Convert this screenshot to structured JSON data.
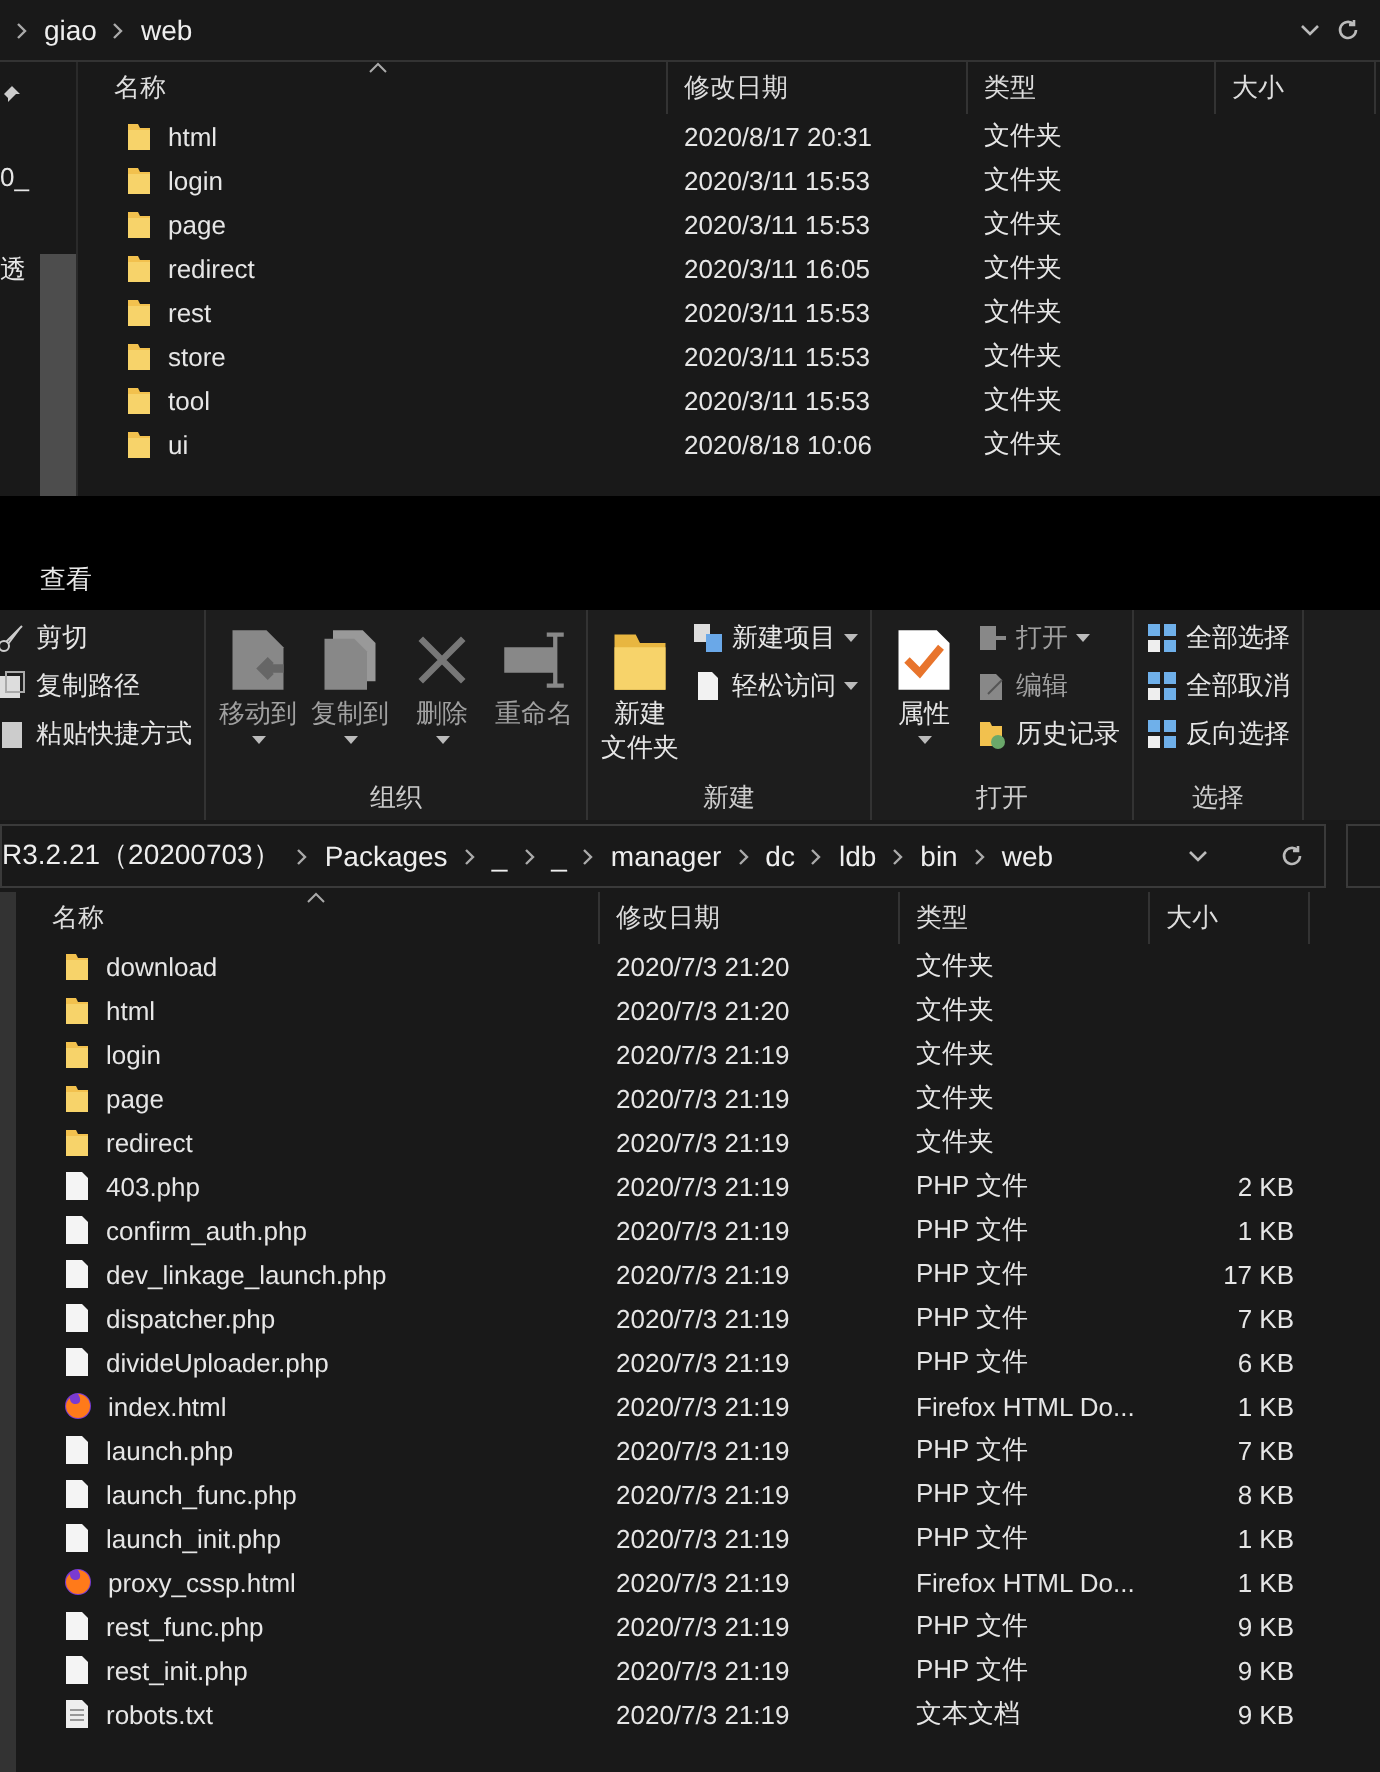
{
  "top_window": {
    "breadcrumb": [
      "giao",
      "web"
    ],
    "nav_pane": {
      "items": [
        "0_",
        "透"
      ]
    },
    "columns": [
      "名称",
      "修改日期",
      "类型",
      "大小"
    ],
    "rows": [
      {
        "name": "html",
        "modified": "2020/8/17 20:31",
        "type": "文件夹",
        "kind": "folder"
      },
      {
        "name": "login",
        "modified": "2020/3/11 15:53",
        "type": "文件夹",
        "kind": "folder"
      },
      {
        "name": "page",
        "modified": "2020/3/11 15:53",
        "type": "文件夹",
        "kind": "folder"
      },
      {
        "name": "redirect",
        "modified": "2020/3/11 16:05",
        "type": "文件夹",
        "kind": "folder"
      },
      {
        "name": "rest",
        "modified": "2020/3/11 15:53",
        "type": "文件夹",
        "kind": "folder"
      },
      {
        "name": "store",
        "modified": "2020/3/11 15:53",
        "type": "文件夹",
        "kind": "folder"
      },
      {
        "name": "tool",
        "modified": "2020/3/11 15:53",
        "type": "文件夹",
        "kind": "folder"
      },
      {
        "name": "ui",
        "modified": "2020/8/18 10:06",
        "type": "文件夹",
        "kind": "folder"
      }
    ]
  },
  "ribbon": {
    "tab": "查看",
    "groups": [
      {
        "items": [
          {
            "label": "剪切",
            "kind": "small",
            "disabled": false,
            "dropdown": false
          },
          {
            "label": "复制路径",
            "kind": "small",
            "disabled": false,
            "dropdown": false
          },
          {
            "label": "粘贴快捷方式",
            "kind": "small",
            "disabled": false,
            "dropdown": false
          }
        ]
      },
      {
        "label": "组织",
        "items": [
          {
            "label": "移动到",
            "kind": "large",
            "disabled": true,
            "dropdown": true
          },
          {
            "label": "复制到",
            "kind": "large",
            "disabled": true,
            "dropdown": true
          },
          {
            "label": "删除",
            "kind": "large",
            "disabled": true,
            "dropdown": true
          },
          {
            "label": "重命名",
            "kind": "large",
            "disabled": true,
            "dropdown": false
          }
        ]
      },
      {
        "label": "新建",
        "items": [
          {
            "label": "新建文件夹",
            "kind": "large",
            "disabled": false,
            "dropdown": false
          },
          {
            "label": "新建项目",
            "kind": "small",
            "disabled": false,
            "dropdown": true
          },
          {
            "label": "轻松访问",
            "kind": "small",
            "disabled": false,
            "dropdown": true
          }
        ]
      },
      {
        "label": "打开",
        "items": [
          {
            "label": "属性",
            "kind": "large",
            "disabled": false,
            "dropdown": true
          },
          {
            "label": "打开",
            "kind": "small",
            "disabled": true,
            "dropdown": true
          },
          {
            "label": "编辑",
            "kind": "small",
            "disabled": true,
            "dropdown": false
          },
          {
            "label": "历史记录",
            "kind": "small",
            "disabled": false,
            "dropdown": false
          }
        ]
      },
      {
        "label": "选择",
        "items": [
          {
            "label": "全部选择",
            "kind": "small",
            "disabled": false,
            "dropdown": false
          },
          {
            "label": "全部取消",
            "kind": "small",
            "disabled": false,
            "dropdown": false
          },
          {
            "label": "反向选择",
            "kind": "small",
            "disabled": false,
            "dropdown": false
          }
        ]
      }
    ]
  },
  "bottom_window": {
    "breadcrumb": [
      "R3.2.21（20200703）",
      "Packages",
      "_",
      "_",
      "manager",
      "dc",
      "ldb",
      "bin",
      "web"
    ],
    "columns": [
      "名称",
      "修改日期",
      "类型",
      "大小"
    ],
    "rows": [
      {
        "name": "download",
        "modified": "2020/7/3 21:20",
        "type": "文件夹",
        "kind": "folder"
      },
      {
        "name": "html",
        "modified": "2020/7/3 21:20",
        "type": "文件夹",
        "kind": "folder"
      },
      {
        "name": "login",
        "modified": "2020/7/3 21:19",
        "type": "文件夹",
        "kind": "folder"
      },
      {
        "name": "page",
        "modified": "2020/7/3 21:19",
        "type": "文件夹",
        "kind": "folder"
      },
      {
        "name": "redirect",
        "modified": "2020/7/3 21:19",
        "type": "文件夹",
        "kind": "folder"
      },
      {
        "name": "403.php",
        "modified": "2020/7/3 21:19",
        "type": "PHP 文件",
        "size": "2 KB",
        "kind": "file"
      },
      {
        "name": "confirm_auth.php",
        "modified": "2020/7/3 21:19",
        "type": "PHP 文件",
        "size": "1 KB",
        "kind": "file"
      },
      {
        "name": "dev_linkage_launch.php",
        "modified": "2020/7/3 21:19",
        "type": "PHP 文件",
        "size": "17 KB",
        "kind": "file"
      },
      {
        "name": "dispatcher.php",
        "modified": "2020/7/3 21:19",
        "type": "PHP 文件",
        "size": "7 KB",
        "kind": "file"
      },
      {
        "name": "divideUploader.php",
        "modified": "2020/7/3 21:19",
        "type": "PHP 文件",
        "size": "6 KB",
        "kind": "file"
      },
      {
        "name": "index.html",
        "modified": "2020/7/3 21:19",
        "type": "Firefox HTML Do...",
        "size": "1 KB",
        "kind": "browser"
      },
      {
        "name": "launch.php",
        "modified": "2020/7/3 21:19",
        "type": "PHP 文件",
        "size": "7 KB",
        "kind": "file"
      },
      {
        "name": "launch_func.php",
        "modified": "2020/7/3 21:19",
        "type": "PHP 文件",
        "size": "8 KB",
        "kind": "file"
      },
      {
        "name": "launch_init.php",
        "modified": "2020/7/3 21:19",
        "type": "PHP 文件",
        "size": "1 KB",
        "kind": "file"
      },
      {
        "name": "proxy_cssp.html",
        "modified": "2020/7/3 21:19",
        "type": "Firefox HTML Do...",
        "size": "1 KB",
        "kind": "browser"
      },
      {
        "name": "rest_func.php",
        "modified": "2020/7/3 21:19",
        "type": "PHP 文件",
        "size": "9 KB",
        "kind": "file"
      },
      {
        "name": "rest_init.php",
        "modified": "2020/7/3 21:19",
        "type": "PHP 文件",
        "size": "9 KB",
        "kind": "file"
      },
      {
        "name": "robots.txt",
        "modified": "2020/7/3 21:19",
        "type": "文本文档",
        "size": "9 KB",
        "kind": "text"
      }
    ]
  }
}
